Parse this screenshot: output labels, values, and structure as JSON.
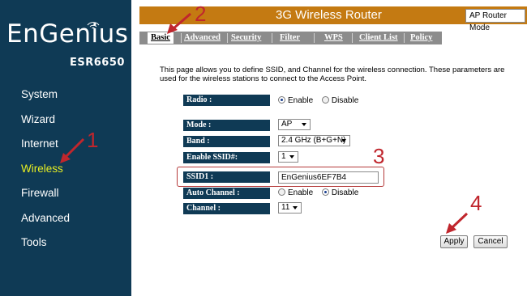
{
  "brand": {
    "logo": "EnGenius",
    "model": "ESR6650"
  },
  "sidebar": {
    "items": [
      {
        "label": "System"
      },
      {
        "label": "Wizard"
      },
      {
        "label": "Internet"
      },
      {
        "label": "Wireless",
        "active": true
      },
      {
        "label": "Firewall"
      },
      {
        "label": "Advanced"
      },
      {
        "label": "Tools"
      }
    ]
  },
  "header": {
    "title": "3G Wireless Router",
    "mode": "AP Router Mode"
  },
  "tabs": [
    {
      "label": "Basic",
      "active": true
    },
    {
      "label": "Advanced"
    },
    {
      "label": "Security"
    },
    {
      "label": "Filter"
    },
    {
      "label": "WPS"
    },
    {
      "label": "Client List"
    },
    {
      "label": "Policy"
    }
  ],
  "intro": "This page allows you to define SSID, and Channel for the wireless connection. These parameters are used for the wireless stations to connect to the Access Point.",
  "form": {
    "radio": {
      "label": "Radio :",
      "enable": "Enable",
      "disable": "Disable",
      "value": "Enable"
    },
    "mode": {
      "label": "Mode :",
      "value": "AP"
    },
    "band": {
      "label": "Band :",
      "value": "2.4 GHz (B+G+N)"
    },
    "enable_ssid": {
      "label": "Enable SSID#:",
      "value": "1"
    },
    "ssid1": {
      "label": "SSID1 :",
      "value": "EnGenius6EF7B4"
    },
    "auto_channel": {
      "label": "Auto Channel :",
      "enable": "Enable",
      "disable": "Disable",
      "value": "Disable"
    },
    "channel": {
      "label": "Channel :",
      "value": "11"
    }
  },
  "buttons": {
    "apply": "Apply",
    "cancel": "Cancel"
  },
  "annotations": {
    "n1": "1",
    "n2": "2",
    "n3": "3",
    "n4": "4",
    "color": "#c0262d"
  },
  "colors": {
    "sidebar": "#0f3a55",
    "header": "#c47a12",
    "tabbar": "#8c8c8c",
    "active_nav": "#e7ee22"
  }
}
